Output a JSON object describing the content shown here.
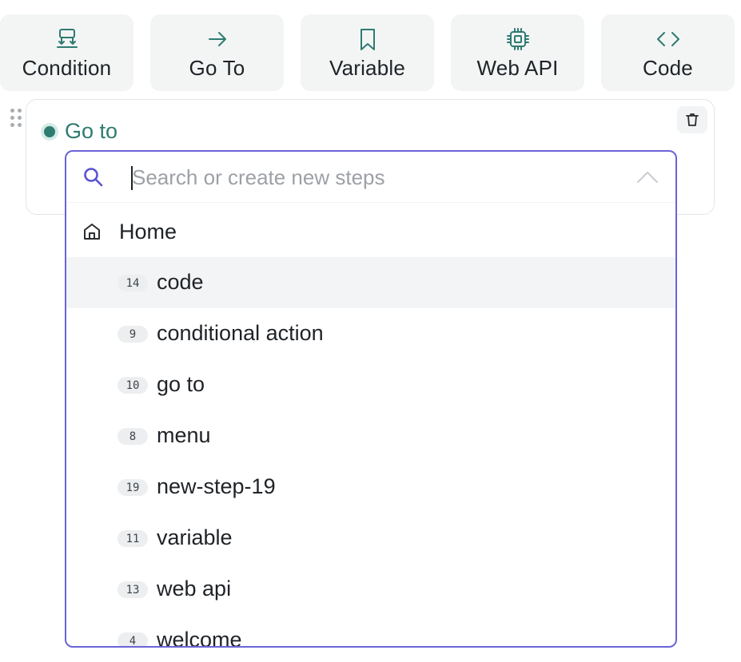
{
  "toolbar": {
    "items": [
      {
        "label": "Condition",
        "icon": "condition-icon"
      },
      {
        "label": "Go To",
        "icon": "arrow-right-icon"
      },
      {
        "label": "Variable",
        "icon": "bookmark-icon"
      },
      {
        "label": "Web API",
        "icon": "cpu-chip-icon"
      },
      {
        "label": "Code",
        "icon": "code-brackets-icon"
      }
    ]
  },
  "step": {
    "title": "Go to",
    "status_color": "#2f7b71",
    "delete_icon": "trash-icon"
  },
  "dropdown": {
    "search_placeholder": "Search or create new steps",
    "search_value": "",
    "accent": "#6b63d8",
    "home_label": "Home",
    "items": [
      {
        "num": "14",
        "label": "code",
        "active": true
      },
      {
        "num": "9",
        "label": "conditional action"
      },
      {
        "num": "10",
        "label": "go to"
      },
      {
        "num": "8",
        "label": "menu"
      },
      {
        "num": "19",
        "label": "new-step-19"
      },
      {
        "num": "11",
        "label": "variable"
      },
      {
        "num": "13",
        "label": "web api"
      },
      {
        "num": "4",
        "label": "welcome"
      }
    ]
  }
}
